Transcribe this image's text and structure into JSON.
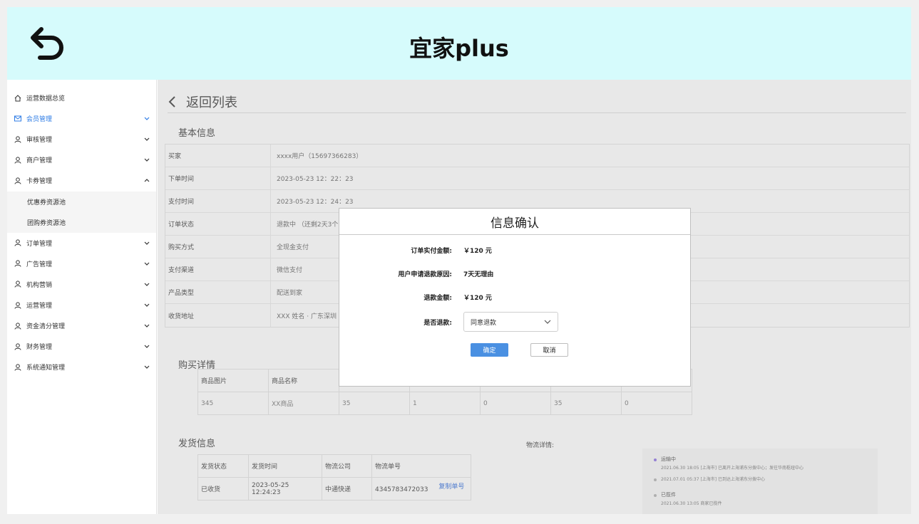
{
  "header": {
    "title": "宜家plus"
  },
  "sidebar": {
    "items": [
      {
        "label": "运营数据总览",
        "icon": "home-icon",
        "chevron": "none",
        "active": false,
        "sub": false
      },
      {
        "label": "会员管理",
        "icon": "mail-icon",
        "chevron": "down",
        "active": true,
        "sub": false
      },
      {
        "label": "审核管理",
        "icon": "user-icon",
        "chevron": "down",
        "active": false,
        "sub": false
      },
      {
        "label": "商户管理",
        "icon": "user-icon",
        "chevron": "down",
        "active": false,
        "sub": false
      },
      {
        "label": "卡券管理",
        "icon": "user-icon",
        "chevron": "up",
        "active": false,
        "sub": false
      },
      {
        "label": "优惠券资源池",
        "icon": "",
        "chevron": "none",
        "active": false,
        "sub": true
      },
      {
        "label": "团购券资源池",
        "icon": "",
        "chevron": "none",
        "active": false,
        "sub": true
      },
      {
        "label": "订单管理",
        "icon": "user-icon",
        "chevron": "down",
        "active": false,
        "sub": false
      },
      {
        "label": "广告管理",
        "icon": "user-icon",
        "chevron": "down",
        "active": false,
        "sub": false
      },
      {
        "label": "机构营销",
        "icon": "user-icon",
        "chevron": "down",
        "active": false,
        "sub": false
      },
      {
        "label": "运营管理",
        "icon": "user-icon",
        "chevron": "down",
        "active": false,
        "sub": false
      },
      {
        "label": "资金清分管理",
        "icon": "user-icon",
        "chevron": "down",
        "active": false,
        "sub": false
      },
      {
        "label": "财务管理",
        "icon": "user-icon",
        "chevron": "down",
        "active": false,
        "sub": false
      },
      {
        "label": "系统通知管理",
        "icon": "user-icon",
        "chevron": "down",
        "active": false,
        "sub": false
      }
    ]
  },
  "main": {
    "back_label": "返回列表",
    "basic_title": "基本信息",
    "basic_rows": [
      {
        "key": "买家",
        "value": "xxxx用户（15697366283）"
      },
      {
        "key": "下单时间",
        "value": "2023-05-23  12：22：23"
      },
      {
        "key": "支付时间",
        "value": "2023-05-23  12：24：23"
      },
      {
        "key": "订单状态",
        "value": "退款中 （还剩2天3个"
      },
      {
        "key": "购买方式",
        "value": "全现金支付"
      },
      {
        "key": "支付渠道",
        "value": "微信支付"
      },
      {
        "key": "产品类型",
        "value": "配送到家"
      },
      {
        "key": "收货地址",
        "value": "XXX 姓名    ·  广东深圳"
      }
    ],
    "buy_title": "购买详情",
    "buy_headers": [
      "商品图片",
      "商品名称",
      "",
      "",
      "",
      "",
      ""
    ],
    "buy_values": [
      "345",
      "XX商品",
      "35",
      "1",
      "0",
      "35",
      "0"
    ],
    "ship_title": "发货信息",
    "ship_headers": [
      "发货状态",
      "发货时间",
      "物流公司",
      "物流单号"
    ],
    "ship_values": {
      "status": "已收货",
      "time": "2023-05-25  12:24:23",
      "company": "中通快递",
      "number": "4345783472033",
      "copy": "复制单号"
    },
    "logistics_label": "物流详情:",
    "logistics": [
      {
        "status": "运输中",
        "detail": "2021.06.30  18:05   [上海市] 已离开上海浦东分拨中心；发往华南枢纽中心",
        "current": true
      },
      {
        "status": "",
        "detail": "2021.07.01  05:37   [上海市] 已到达上海浦东分拨中心",
        "current": false
      },
      {
        "status": "已揽件",
        "detail": "2021.06.30  13:05   商家已揽件",
        "current": false
      }
    ]
  },
  "modal": {
    "title": "信息确认",
    "rows": [
      {
        "key": "订单实付金额:",
        "value": "￥120 元"
      },
      {
        "key": "用户申请退款原因:",
        "value": "7天无理由"
      },
      {
        "key": "退款金额:",
        "value": "￥120 元"
      }
    ],
    "refund_label": "是否退款:",
    "refund_selected": "同意退款",
    "ok_label": "确定",
    "cancel_label": "取消"
  },
  "colors": {
    "header_bg": "#d6fbfc",
    "accent": "#4a90e2",
    "active_menu": "#2c7be5",
    "received": "#43b04a"
  }
}
